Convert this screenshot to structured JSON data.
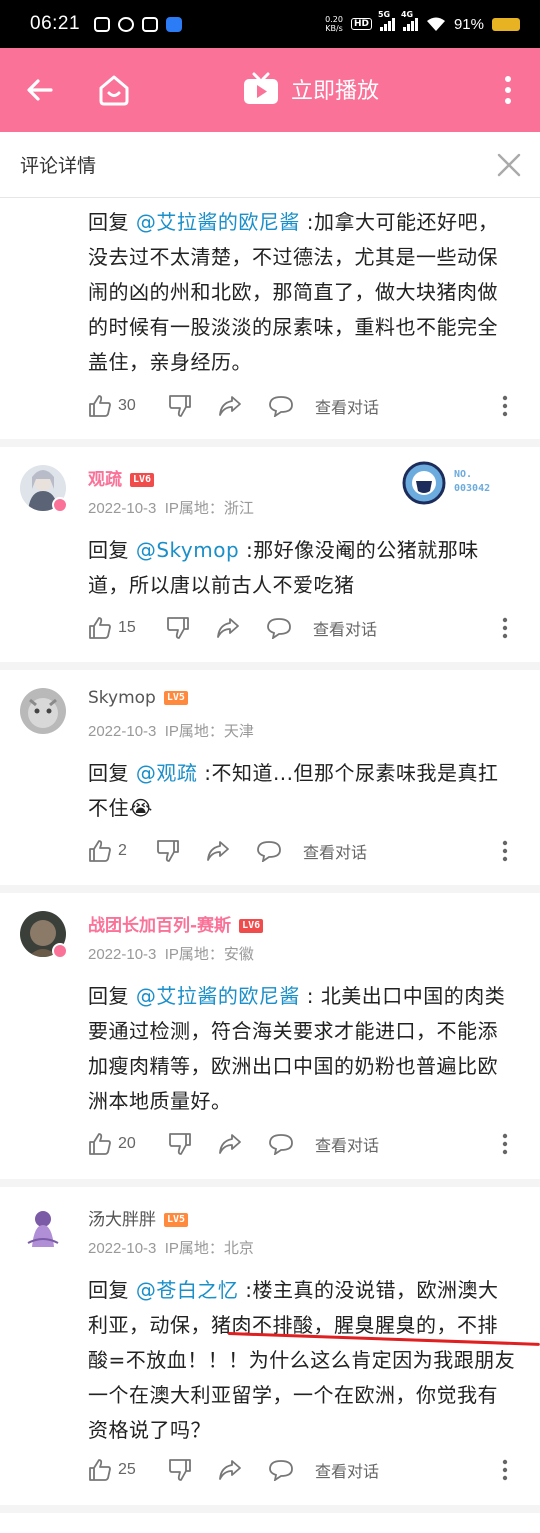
{
  "status": {
    "time": "06:21",
    "speed_top": "0.20",
    "speed_unit": "KB/s",
    "hd": "HD",
    "sig1": "5G",
    "sig2": "4G",
    "battery": "91%"
  },
  "header": {
    "title": "立即播放",
    "accent": "#fb7299"
  },
  "sheet": {
    "title": "评论详情"
  },
  "actions_label": "查看对话",
  "comments": [
    {
      "reply_prefix": "回复 ",
      "mention": "@艾拉酱的欧尼酱",
      "text": " :加拿大可能还好吧，没去过不太清楚，不过德法，尤其是一些动保闹的凶的州和北欧，那简直了，做大块猪肉做的时候有一股淡淡的尿素味，重料也不能完全盖住，亲身经历。",
      "likes": "30"
    },
    {
      "name": "观疏",
      "level": "LV6",
      "date": "2022-10-3",
      "ip": "IP属地：浙江",
      "badge_no": "NO.",
      "badge_num": "003042",
      "reply_prefix": "回复 ",
      "mention": "@Skymop",
      "text": " :那好像没阉的公猪就那味道，所以唐以前古人不爱吃猪",
      "likes": "15"
    },
    {
      "name": "Skymop",
      "level": "LV5",
      "date": "2022-10-3",
      "ip": "IP属地：天津",
      "reply_prefix": "回复 ",
      "mention": "@观疏",
      "text": " :不知道...但那个尿素味我是真扛不住",
      "emoji": "😭",
      "likes": "2"
    },
    {
      "name": "战团长加百列-赛斯",
      "level": "LV6",
      "date": "2022-10-3",
      "ip": "IP属地：安徽",
      "reply_prefix": "回复 ",
      "mention": "@艾拉酱的欧尼酱",
      "text": " : 北美出口中国的肉类要通过检测，符合海关要求才能进口，不能添加瘦肉精等，欧洲出口中国的奶粉也普遍比欧洲本地质量好。",
      "likes": "20"
    },
    {
      "name": "汤大胖胖",
      "level": "LV5",
      "date": "2022-10-3",
      "ip": "IP属地：北京",
      "reply_prefix": "回复 ",
      "mention": "@苍白之忆",
      "text": " :楼主真的没说错，欧洲澳大利亚，动保，猪肉不排酸，腥臭腥臭的，不排酸=不放血！！！为什么这么肯定因为我跟朋友一个在澳大利亚留学，一个在欧洲，你觉我有资格说了吗？",
      "likes": "25"
    }
  ]
}
